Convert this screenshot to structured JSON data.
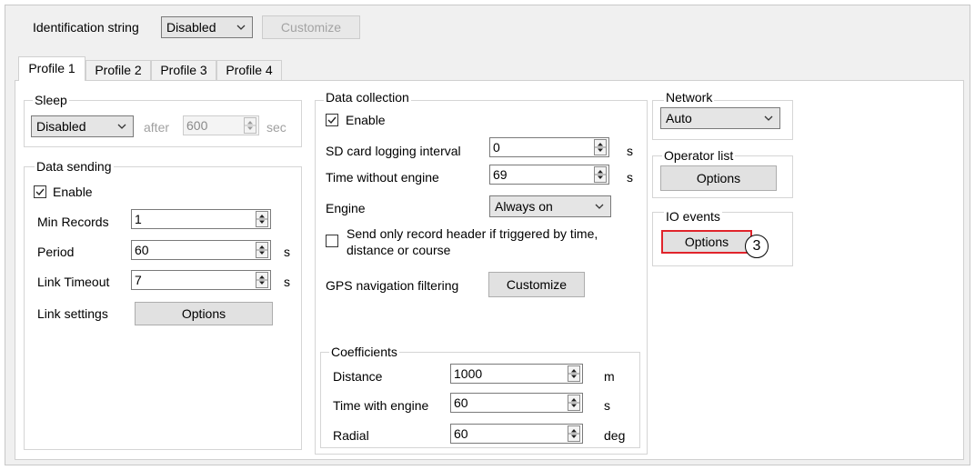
{
  "header": {
    "id_string_label": "Identification string",
    "id_string_value": "Disabled",
    "customize_label": "Customize"
  },
  "tabs": [
    {
      "label": "Profile 1",
      "active": true
    },
    {
      "label": "Profile 2",
      "active": false
    },
    {
      "label": "Profile 3",
      "active": false
    },
    {
      "label": "Profile 4",
      "active": false
    }
  ],
  "sleep": {
    "title": "Sleep",
    "mode": "Disabled",
    "after_label": "after",
    "after_value": "600",
    "unit": "sec"
  },
  "data_sending": {
    "title": "Data sending",
    "enable_label": "Enable",
    "enabled": true,
    "min_records_label": "Min Records",
    "min_records_value": "1",
    "period_label": "Period",
    "period_value": "60",
    "period_unit": "s",
    "link_timeout_label": "Link Timeout",
    "link_timeout_value": "7",
    "link_timeout_unit": "s",
    "link_settings_label": "Link settings",
    "options_label": "Options"
  },
  "data_collection": {
    "title": "Data collection",
    "enable_label": "Enable",
    "enabled": true,
    "sd_label": "SD card logging interval",
    "sd_value": "0",
    "sd_unit": "s",
    "twe_label": "Time without engine",
    "twe_value": "69",
    "twe_unit": "s",
    "engine_label": "Engine",
    "engine_value": "Always on",
    "header_only_line1": "Send only record header if triggered by time,",
    "header_only_line2": "distance or course",
    "header_only_checked": false,
    "gps_label": "GPS navigation filtering",
    "gps_button": "Customize"
  },
  "coefficients": {
    "title": "Coefficients",
    "distance_label": "Distance",
    "distance_value": "1000",
    "distance_unit": "m",
    "twe_label": "Time with engine",
    "twe_value": "60",
    "twe_unit": "s",
    "radial_label": "Radial",
    "radial_value": "60",
    "radial_unit": "deg"
  },
  "network": {
    "title": "Network",
    "value": "Auto"
  },
  "operator_list": {
    "title": "Operator list",
    "button": "Options"
  },
  "io_events": {
    "title": "IO events",
    "button": "Options",
    "callout": "3"
  },
  "colors": {
    "highlight": "#e0242b"
  }
}
